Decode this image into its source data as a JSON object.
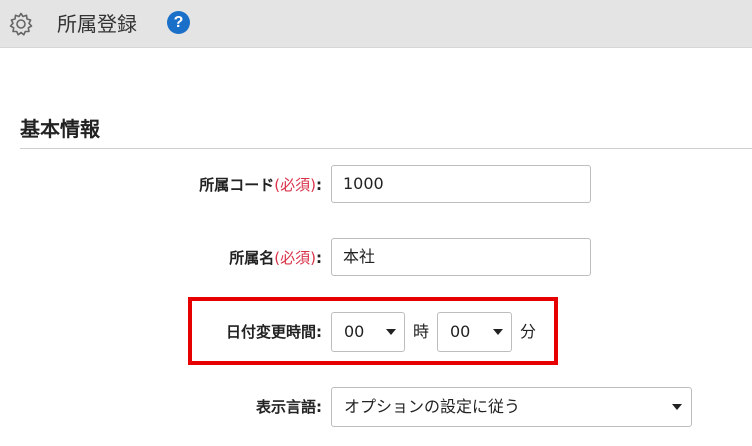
{
  "header": {
    "title": "所属登録",
    "settings_icon": "gear-icon",
    "help_icon": "question-circle-icon",
    "help_glyph": "?"
  },
  "section": {
    "title": "基本情報"
  },
  "fields": {
    "code": {
      "label": "所属コード",
      "required": "(必須)",
      "colon": ":",
      "value": "1000"
    },
    "name": {
      "label": "所属名",
      "required": "(必須)",
      "colon": ":",
      "value": "本社"
    },
    "date_change": {
      "label": "日付変更時間",
      "colon": ":",
      "hour_value": "00",
      "hour_unit": "時",
      "minute_value": "00",
      "minute_unit": "分"
    },
    "language": {
      "label": "表示言語",
      "colon": ":",
      "value": "オプションの設定に従う"
    }
  },
  "colors": {
    "required_text": "#d9334a",
    "highlight_border": "#e60000",
    "help_icon": "#1a6fc9"
  }
}
